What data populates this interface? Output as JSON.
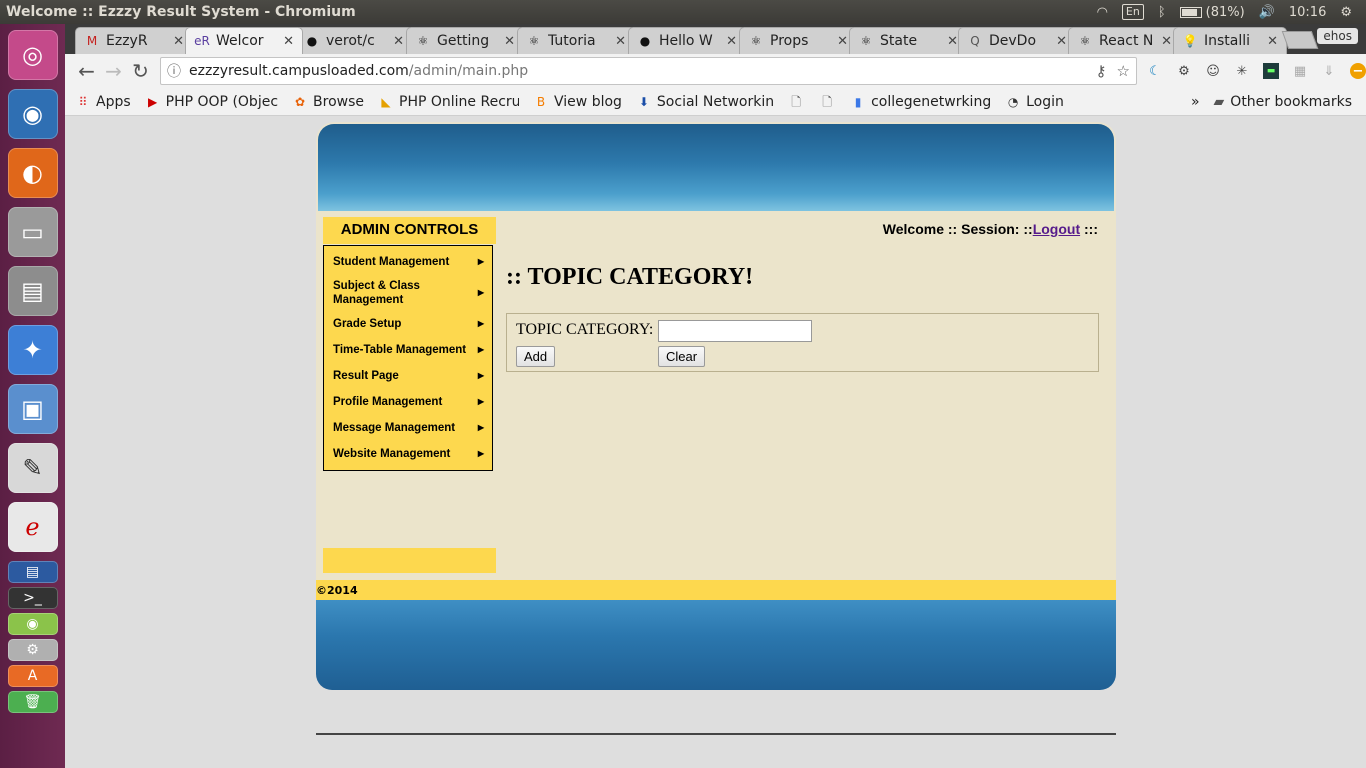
{
  "panel": {
    "window_title": "Welcome :: Ezzzy Result System - Chromium",
    "lang": "En",
    "battery": "(81%)",
    "clock": "10:16"
  },
  "launcher": {
    "apps": [
      "ubuntu-dash",
      "chromium",
      "firefox",
      "disk",
      "files",
      "network",
      "virtualbox",
      "text-editor",
      "pdf-reader",
      "impress",
      "terminal",
      "android-studio",
      "settings",
      "software-center",
      "trash"
    ]
  },
  "tabs": [
    {
      "label": "EzzyR",
      "icon": "gmail-icon",
      "glyph": "M",
      "color": "#c5221f",
      "active": false
    },
    {
      "label": "Welcor",
      "icon": "ezzy-icon",
      "glyph": "eR",
      "color": "#5a3fa0",
      "active": true
    },
    {
      "label": "verot/c",
      "icon": "github-icon",
      "glyph": "●",
      "color": "#111",
      "active": false
    },
    {
      "label": "Getting",
      "icon": "react-icon",
      "glyph": "⚛",
      "color": "#111",
      "active": false
    },
    {
      "label": "Tutoria",
      "icon": "react-icon",
      "glyph": "⚛",
      "color": "#111",
      "active": false
    },
    {
      "label": "Hello W",
      "icon": "github-icon",
      "glyph": "●",
      "color": "#111",
      "active": false
    },
    {
      "label": "Props",
      "icon": "react-icon",
      "glyph": "⚛",
      "color": "#111",
      "active": false
    },
    {
      "label": "State",
      "icon": "react-icon",
      "glyph": "⚛",
      "color": "#111",
      "active": false
    },
    {
      "label": "DevDo",
      "icon": "devdocs-icon",
      "glyph": "Q",
      "color": "#555",
      "active": false
    },
    {
      "label": "React N",
      "icon": "react-icon",
      "glyph": "⚛",
      "color": "#111",
      "active": false
    },
    {
      "label": "Installi",
      "icon": "bulb-icon",
      "glyph": "💡",
      "color": "#e0a800",
      "active": false
    }
  ],
  "profile": "ehos",
  "address": {
    "host": "ezzzyresult.campusloaded.com",
    "path": "/admin/main.php"
  },
  "bookmarks": [
    {
      "label": "Apps",
      "icon": "apps-grid-icon",
      "glyph": "⠿",
      "color": "#d33"
    },
    {
      "label": "PHP OOP (Objec",
      "icon": "youtube-icon",
      "glyph": "▶",
      "color": "#c00"
    },
    {
      "label": "Browse",
      "icon": "browse-icon",
      "glyph": "✿",
      "color": "#e8630a"
    },
    {
      "label": "PHP Online Recru",
      "icon": "bookmark-icon",
      "glyph": "◣",
      "color": "#e5a100"
    },
    {
      "label": "View blog",
      "icon": "blogger-icon",
      "glyph": "B",
      "color": "#f57d00"
    },
    {
      "label": "Social Networkin",
      "icon": "download-icon",
      "glyph": "⬇",
      "color": "#1a4ea8"
    },
    {
      "label": "",
      "icon": "page-icon",
      "glyph": "🗋",
      "color": "#555"
    },
    {
      "label": "",
      "icon": "page-icon",
      "glyph": "🗋",
      "color": "#555"
    },
    {
      "label": "collegenetwrking",
      "icon": "doc-icon",
      "glyph": "▮",
      "color": "#3b78e7"
    },
    {
      "label": "Login",
      "icon": "login-icon",
      "glyph": "◔",
      "color": "#333"
    }
  ],
  "bookmarks_more": "»",
  "other_bookmarks": "Other bookmarks",
  "site": {
    "admin_title": "ADMIN CONTROLS",
    "menu": [
      "Student Management",
      "Subject & Class Management",
      "Grade Setup",
      "Time-Table Management",
      "Result Page",
      "Profile Management",
      "Message Management",
      "Website Management"
    ],
    "welcome_prefix": "Welcome :: Session: ::",
    "logout": "Logout",
    "welcome_suffix": " :::",
    "page_title": ":: TOPIC CATEGORY!",
    "form": {
      "label": "TOPIC CATEGORY:",
      "value": "",
      "add": "Add",
      "clear": "Clear"
    },
    "footer": "©2014"
  }
}
